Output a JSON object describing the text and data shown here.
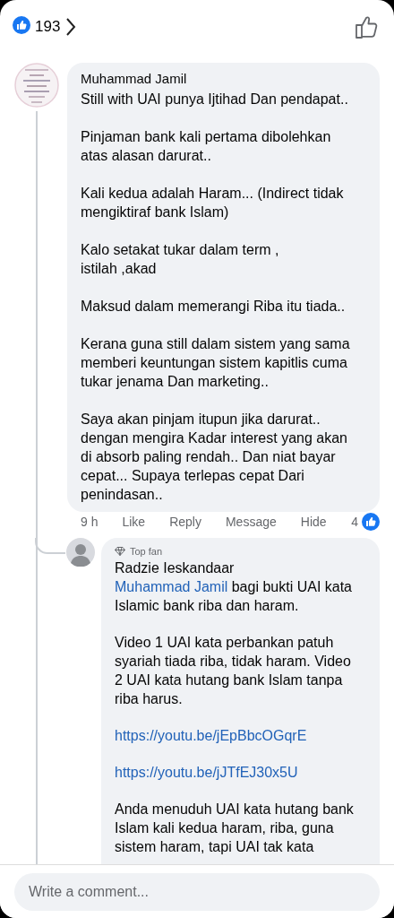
{
  "header": {
    "like_count": "193"
  },
  "comment": {
    "author": "Muhammad Jamil",
    "paragraphs": [
      "Still with UAI punya Ijtihad Dan pendapat..",
      "Pinjaman bank kali pertama dibolehkan\natas alasan darurat..",
      "Kali kedua adalah Haram... (Indirect tidak\nmengiktiraf bank Islam)",
      "Kalo setakat tukar dalam term ,\nistilah ,akad",
      "Maksud dalam memerangi Riba itu tiada..",
      "Kerana guna still dalam sistem yang sama\nmemberi keuntungan sistem kapitlis cuma\ntukar jenama Dan marketing..",
      "Saya akan pinjam itupun jika darurat..\ndengan mengira Kadar interest yang akan\ndi absorb paling rendah.. Dan niat bayar\ncepat... Supaya terlepas cepat Dari\npenindasan.."
    ],
    "time": "9 h",
    "actions": [
      "Like",
      "Reply",
      "Message",
      "Hide"
    ],
    "reaction_count": "4"
  },
  "reply": {
    "badge": "Top fan",
    "author": "Radzie Ieskandaar",
    "mention": "Muhammad Jamil",
    "paragraphs": [
      {
        "kind": "mention_text",
        "text": " bagi bukti UAI kata\nIslamic bank riba dan haram."
      },
      {
        "kind": "text",
        "text": "Video 1 UAI kata perbankan patuh\nsyariah tiada riba, tidak haram. Video\n2 UAI kata hutang bank Islam tanpa\nriba harus."
      },
      {
        "kind": "link",
        "text": "https://youtu.be/jEpBbcOGqrE"
      },
      {
        "kind": "link",
        "text": "https://youtu.be/jJTfEJ30x5U"
      },
      {
        "kind": "text",
        "text": "Anda menuduh UAI kata hutang bank\nIslam kali kedua haram, riba, guna\nsistem haram, tapi UAI tak kata"
      }
    ]
  },
  "composer": {
    "placeholder": "Write a comment..."
  }
}
